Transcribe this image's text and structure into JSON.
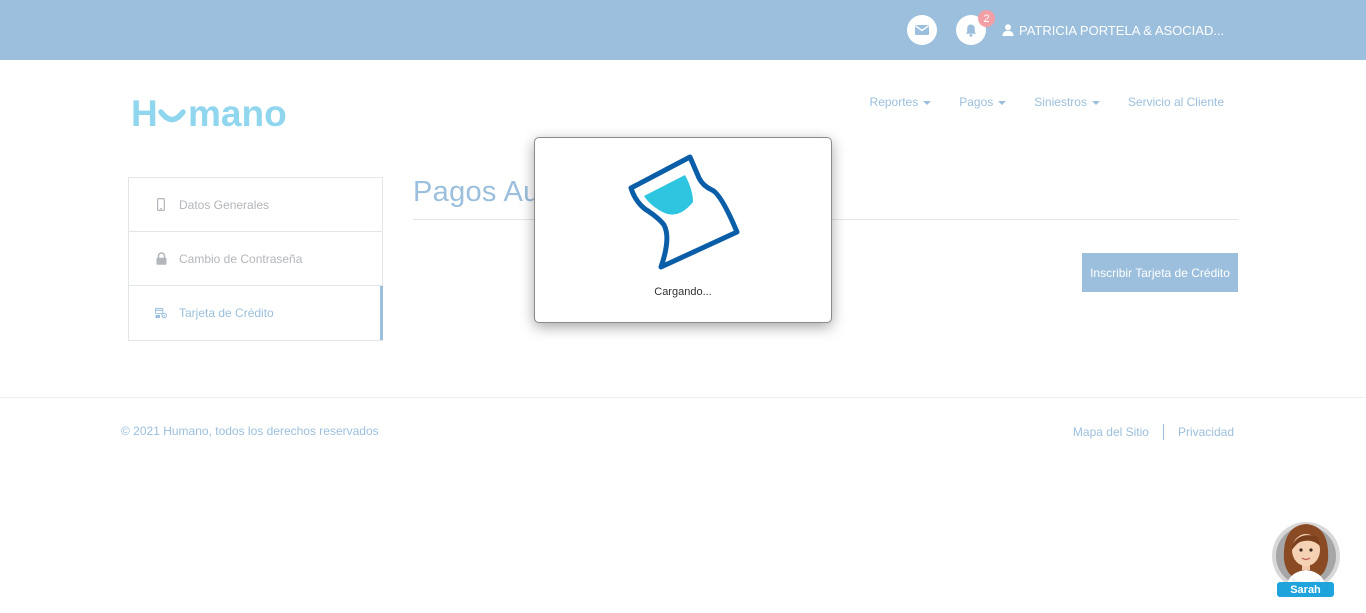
{
  "topbar": {
    "notification_count": "2",
    "user_name": "PATRICIA PORTELA & ASOCIAD..."
  },
  "brand": {
    "logo_text": "Humano"
  },
  "nav": {
    "items": [
      {
        "label": "Reportes",
        "dropdown": true
      },
      {
        "label": "Pagos",
        "dropdown": true
      },
      {
        "label": "Siniestros",
        "dropdown": true
      },
      {
        "label": "Servicio al Cliente",
        "dropdown": false
      }
    ]
  },
  "sidebar": {
    "items": [
      {
        "label": "Datos Generales",
        "icon": "mobile-icon",
        "active": false
      },
      {
        "label": "Cambio de Contraseña",
        "icon": "lock-icon",
        "active": false
      },
      {
        "label": "Tarjeta de Crédito",
        "icon": "credit-card-settings-icon",
        "active": true
      }
    ]
  },
  "main": {
    "title": "Pagos Au",
    "primary_button": "Inscribir Tarjeta de Crédito"
  },
  "modal": {
    "loading_text": "Cargando...",
    "icon": "hourglass-icon"
  },
  "footer": {
    "copyright": "© 2021 Humano, todos los derechos reservados",
    "links": [
      "Mapa del Sitio",
      "Privacidad"
    ]
  },
  "assistant": {
    "name": "Sarah"
  },
  "colors": {
    "topbar": "#9bbfdc",
    "accent": "#9bbfdc",
    "badge": "#f2a0a6",
    "logo": "#8fd6ee",
    "hourglass_outline": "#0a5ea8",
    "hourglass_fill": "#2ec5e0"
  }
}
